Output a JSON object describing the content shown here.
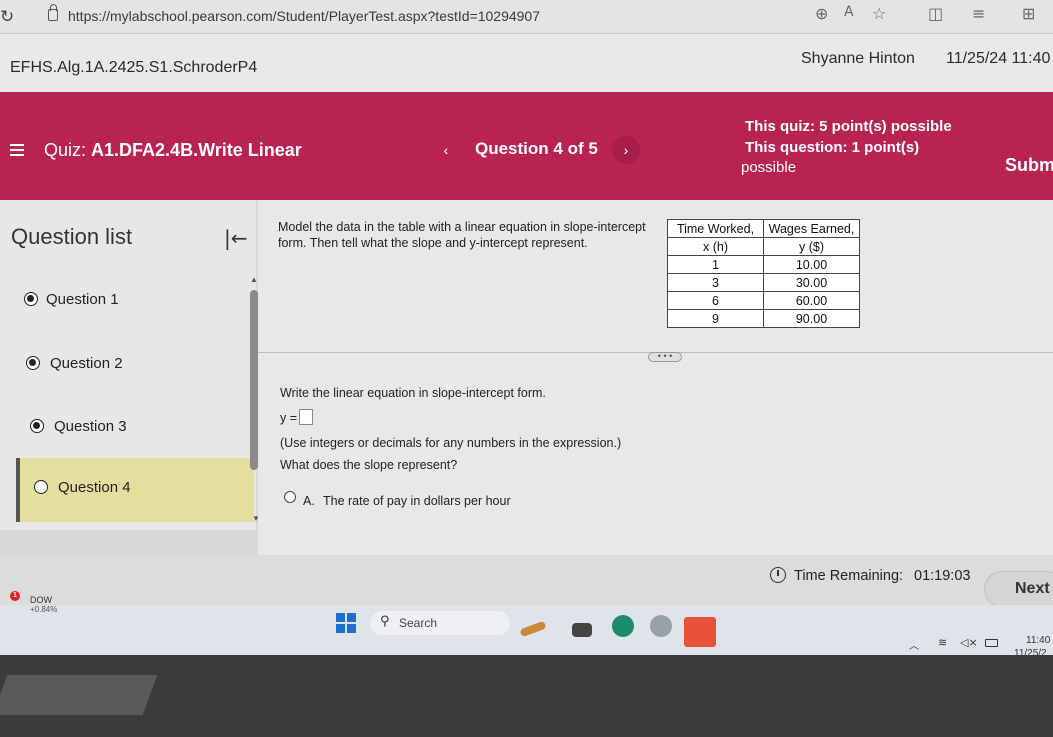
{
  "browser": {
    "url": "https://mylabschool.pearson.com/Student/PlayerTest.aspx?testId=10294907",
    "icons": [
      "reload-icon",
      "zoom-icon",
      "read-aloud-icon",
      "favorite-icon",
      "split-screen-icon",
      "favorites-list-icon",
      "collections-icon"
    ]
  },
  "account": {
    "course": "EFHS.Alg.1A.2425.S1.SchroderP4",
    "user": "Shyanne Hinton",
    "datetime": "11/25/24 11:40"
  },
  "header": {
    "quiz_prefix": "Quiz:",
    "quiz_name": "A1.DFA2.4B.Write Linear",
    "question_position": "Question 4 of 5",
    "quiz_points": "This quiz: 5 point(s) possible",
    "question_points": "This question: 1 point(s)",
    "question_points_cont": "possible",
    "submit_label": "Subm",
    "color": "#b92352"
  },
  "question_list": {
    "title": "Question list",
    "items": [
      {
        "label": "Question 1",
        "answered": true
      },
      {
        "label": "Question 2",
        "answered": true
      },
      {
        "label": "Question 3",
        "answered": true
      },
      {
        "label": "Question 4",
        "answered": false,
        "current": true
      }
    ]
  },
  "question": {
    "instructions": "Model the data in the table with a linear equation in slope-intercept form. Then tell what the slope and y-intercept represent.",
    "table": {
      "headers": [
        "Time Worked,",
        "Wages Earned,"
      ],
      "subheaders": [
        "x (h)",
        "y ($)"
      ],
      "rows": [
        [
          "1",
          "10.00"
        ],
        [
          "3",
          "30.00"
        ],
        [
          "6",
          "60.00"
        ],
        [
          "9",
          "90.00"
        ]
      ]
    },
    "more_label": "• • •",
    "part_instruction": "Write the linear equation in slope-intercept form.",
    "y_prefix": "y =",
    "answer_value": "",
    "answer_note": "(Use integers or decimals for any numbers in the expression.)",
    "slope_question": "What does the slope represent?",
    "option_a_letter": "A.",
    "option_a_text": "The rate of pay in dollars per hour"
  },
  "footer": {
    "time_label": "Time Remaining:",
    "time_value": "01:19:03",
    "next_label": "Next"
  },
  "taskbar": {
    "stock_alert": "1",
    "stock_name": "DOW",
    "stock_change": "+0.84%",
    "search_label": "Search",
    "time": "11:40",
    "date": "11/25/2"
  }
}
